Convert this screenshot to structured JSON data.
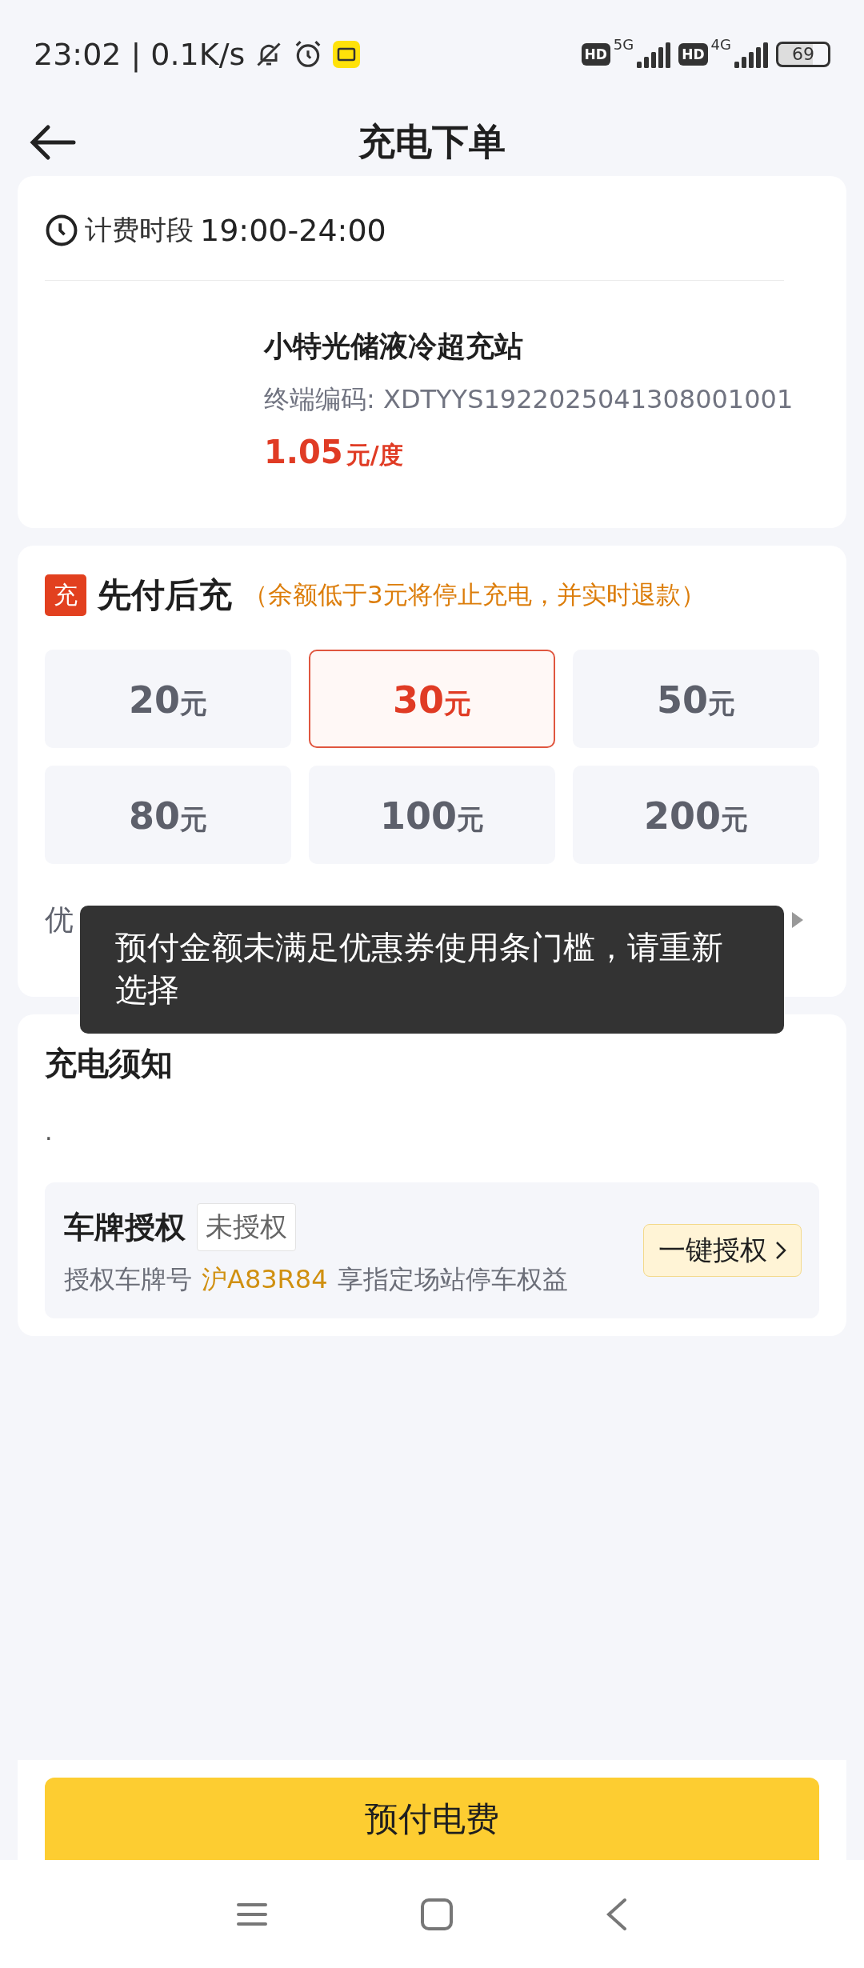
{
  "status_bar": {
    "time": "23:02",
    "separator": "|",
    "speed": "0.1K/s",
    "sims": [
      {
        "badge": "HD",
        "network": "5G"
      },
      {
        "badge": "HD",
        "network": "4G"
      }
    ],
    "battery": "69"
  },
  "header": {
    "title": "充电下单"
  },
  "station_card": {
    "billing_label": "计费时段",
    "billing_period": "19:00-24:00",
    "station_name": "小特光储液冷超充站",
    "terminal_code": "终端编码: XDTYYS1922025041308001001",
    "price": "1.05",
    "price_unit": "元/度"
  },
  "prepay": {
    "badge": "充",
    "title": "先付后充",
    "note": "（余额低于3元将停止充电，并实时退款）",
    "amounts": [
      {
        "value": "20",
        "unit": "元",
        "selected": false
      },
      {
        "value": "30",
        "unit": "元",
        "selected": true
      },
      {
        "value": "50",
        "unit": "元",
        "selected": false
      },
      {
        "value": "80",
        "unit": "元",
        "selected": false
      },
      {
        "value": "100",
        "unit": "元",
        "selected": false
      },
      {
        "value": "200",
        "unit": "元",
        "selected": false
      }
    ],
    "coupon": {
      "label": "优"
    }
  },
  "toast": {
    "message": "预付金额未满足优惠券使用条门槛，请重新选择"
  },
  "notice": {
    "title": "充电须知",
    "body": "."
  },
  "plate_auth": {
    "title": "车牌授权",
    "status": "未授权",
    "desc_prefix": "授权车牌号",
    "plate": "沪A83R84",
    "desc_suffix": "享指定场站停车权益",
    "button": "一键授权"
  },
  "footer": {
    "button": "预付电费"
  }
}
